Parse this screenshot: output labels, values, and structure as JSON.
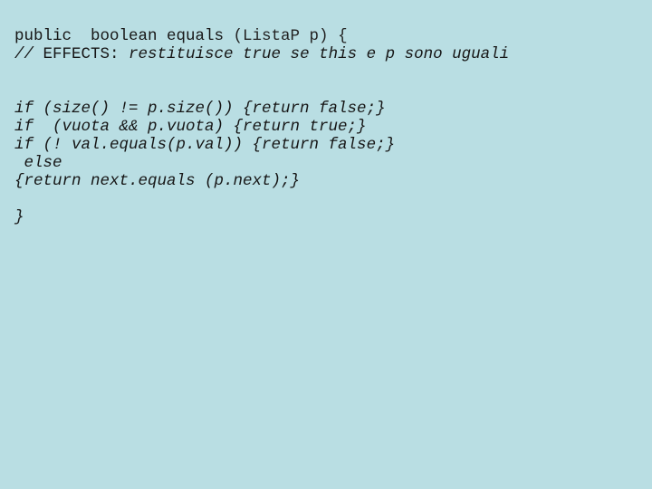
{
  "slide": {
    "background_color": "#b9dee3",
    "text_color": "#161616",
    "title": "public boolean equals (ListaP p)"
  },
  "code": {
    "language": "java",
    "lines": [
      {
        "index": 1,
        "text": "public  boolean equals (ListaP p) {",
        "runs": [
          {
            "style": "roman",
            "text": "public  boolean equals "
          },
          {
            "style": "light",
            "text": "(ListaP p) {"
          }
        ]
      },
      {
        "index": 2,
        "text": "// EFFECTS: restituisce true se this e p sono uguali",
        "runs": [
          {
            "style": "italic",
            "text": "// "
          },
          {
            "style": "roman",
            "text": "EFFECTS:"
          },
          {
            "style": "italic",
            "text": " restituisce true se this e p sono uguali"
          }
        ]
      },
      {
        "index": 3,
        "text": "",
        "runs": []
      },
      {
        "index": 4,
        "text": "",
        "runs": []
      },
      {
        "index": 5,
        "text": "if (size() != p.size()) {return false;}",
        "runs": [
          {
            "style": "italic",
            "text": "if (size() != p.size()) {return false;}"
          }
        ]
      },
      {
        "index": 6,
        "text": "if  (vuota && p.vuota) {return true;}",
        "runs": [
          {
            "style": "italic",
            "text": "if  (vuota && p.vuota) {return true;}"
          }
        ]
      },
      {
        "index": 7,
        "text": "if (! val.equals(p.val)) {return false;}",
        "runs": [
          {
            "style": "italic",
            "text": "if (! val.equals(p.val)) {return false;}"
          }
        ]
      },
      {
        "index": 8,
        "text": " else",
        "runs": [
          {
            "style": "italic",
            "text": " else"
          }
        ]
      },
      {
        "index": 9,
        "text": "{return next.equals (p.next);}",
        "runs": [
          {
            "style": "italic",
            "text": "{return next.equals (p.next);}"
          }
        ]
      },
      {
        "index": 10,
        "text": "",
        "runs": []
      },
      {
        "index": 11,
        "text": "}",
        "runs": [
          {
            "style": "italic",
            "text": "}"
          }
        ]
      }
    ]
  }
}
